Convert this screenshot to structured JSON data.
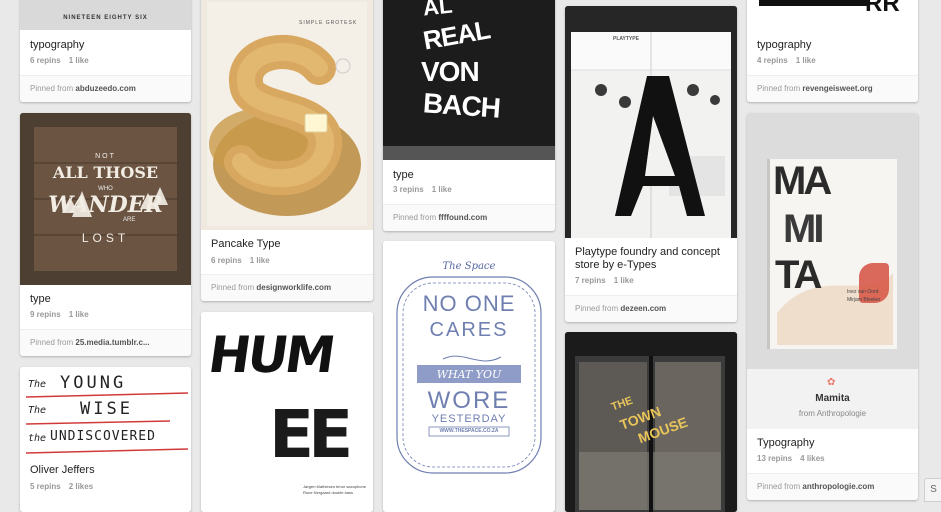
{
  "pins": [
    {
      "id": "c1p1",
      "title": "typography",
      "repins": "6 repins",
      "likes": "1 like",
      "pinned_from": "Pinned from",
      "source": "abduzeedo.com",
      "image_text": "NINETEEN EIGHTY SIX"
    },
    {
      "id": "c1p2",
      "title": "type",
      "repins": "9 repins",
      "likes": "1 like",
      "pinned_from": "Pinned from",
      "source": "25.media.tumblr.c...",
      "image_lines": [
        "NOT",
        "ALL THOSE",
        "WHO",
        "WANDER",
        "ARE",
        "LOST"
      ]
    },
    {
      "id": "c1p3",
      "title": "Oliver Jeffers",
      "repins": "5 repins",
      "likes": "2 likes",
      "image_lines": [
        "The",
        "YOUNG",
        "The",
        "WISE",
        "the",
        "UNDISCOVERED"
      ]
    },
    {
      "id": "c2p1",
      "title": "Pancake Type",
      "repins": "6 repins",
      "likes": "1 like",
      "pinned_from": "Pinned from",
      "source": "designworklife.com",
      "image_lines": [
        "SIMPLE GROTESK",
        "S"
      ]
    },
    {
      "id": "c2p2",
      "image_lines": [
        "HUM",
        "EE",
        "Jørgen Mathiesen  tenor saxophone",
        "Rune Nergaard  double bass"
      ]
    },
    {
      "id": "c3p1",
      "title": "type",
      "repins": "3 repins",
      "likes": "1 like",
      "pinned_from": "Pinned from",
      "source": "ffffound.com",
      "image_lines": [
        "AL",
        "REAL",
        "VON",
        "BACH"
      ]
    },
    {
      "id": "c3p2",
      "image_lines": [
        "The Space",
        "NO ONE",
        "CARES",
        "WHAT YOU",
        "WORE",
        "YESTERDAY",
        "WWW.THESPACE.CO.ZA"
      ]
    },
    {
      "id": "c4p1",
      "title": "Playtype foundry and concept store by e-Types",
      "repins": "7 repins",
      "likes": "1 like",
      "pinned_from": "Pinned from",
      "source": "dezeen.com",
      "image_lines": [
        "PLAYTYPE",
        "A"
      ]
    },
    {
      "id": "c4p2",
      "image_lines": [
        "THE",
        "TOWN",
        "MOUSE"
      ]
    },
    {
      "id": "c5p1",
      "title": "typography",
      "repins": "4 repins",
      "likes": "1 like",
      "pinned_from": "Pinned from",
      "source": "revengeisweet.org",
      "image_text": "RR"
    },
    {
      "id": "c5p2",
      "title": "Typography",
      "repins": "13 repins",
      "likes": "4 likes",
      "pinned_from": "Pinned from",
      "source": "anthropologie.com",
      "board_name": "Mamita",
      "board_from": "from Anthropologie",
      "image_lines": [
        "MA",
        "MI",
        "TA",
        "Inez van Oord",
        "Mirjam Bleeker"
      ]
    }
  ],
  "edge": {
    "label": "S"
  },
  "colors": {
    "background": "#e9e9e9",
    "red_line": "#d23a3a",
    "pinterest_red": "#cb2027"
  }
}
